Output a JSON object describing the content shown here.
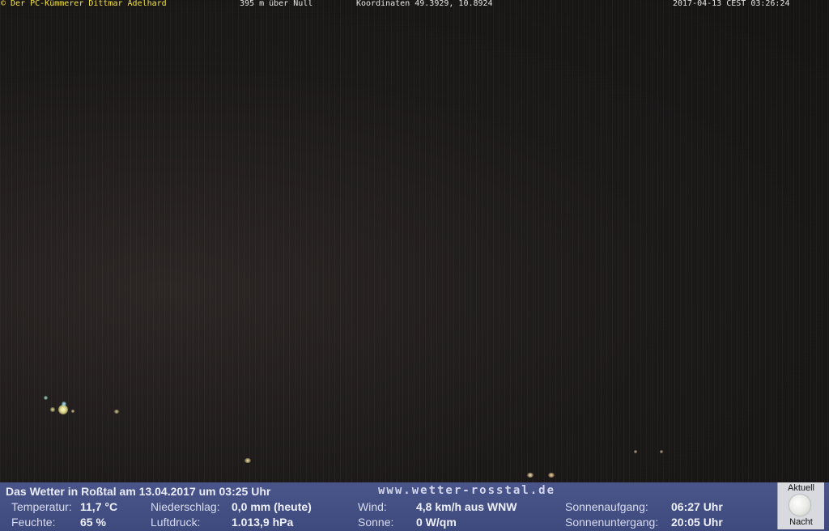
{
  "overlay_top": {
    "copyright": "© Der PC-Kümmerer Dittmar Adelhard",
    "altitude": "395 m über Null",
    "coordinates": "Koordinaten 49.3929, 10.8924",
    "timestamp": "2017-04-13 CEST 03:26:24"
  },
  "weather": {
    "title": "Das Wetter in Roßtal am 13.04.2017 um 03:25 Uhr",
    "website": "www.wetter-rosstal.de",
    "rows": [
      [
        {
          "label": "Temperatur:",
          "value": "11,7 °C"
        },
        {
          "label": "Niederschlag:",
          "value": "0,0 mm (heute)"
        },
        {
          "label": "Wind:",
          "value": "4,8 km/h aus WNW"
        },
        {
          "label": "Sonnenaufgang:",
          "value": "06:27 Uhr"
        }
      ],
      [
        {
          "label": "Feuchte:",
          "value": "65 %"
        },
        {
          "label": "Luftdruck:",
          "value": "1.013,9 hPa"
        },
        {
          "label": "Sonne:",
          "value": "0 W/qm"
        },
        {
          "label": "Sonnenuntergang:",
          "value": "20:05 Uhr"
        }
      ]
    ],
    "moon": {
      "top_label": "Aktuell",
      "bottom_label": "Nacht",
      "icon": "moon-icon"
    }
  },
  "colors": {
    "overlay_yellow": "#f0e24a",
    "panel_blue": "#45508a"
  }
}
